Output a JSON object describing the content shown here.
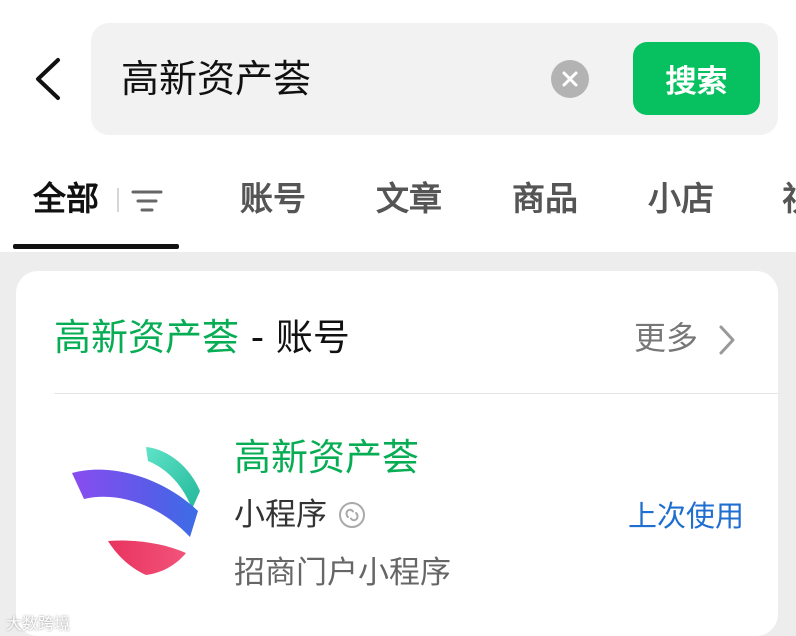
{
  "search": {
    "query": "高新资产荟",
    "button_label": "搜索"
  },
  "tabs": [
    {
      "label": "全部"
    },
    {
      "label": "账号"
    },
    {
      "label": "文章"
    },
    {
      "label": "商品"
    },
    {
      "label": "小店"
    },
    {
      "label": "视"
    }
  ],
  "section": {
    "keyword": "高新资产荟",
    "separator": " - ",
    "category": "账号",
    "more_label": "更多"
  },
  "result": {
    "name": "高新资产荟",
    "type": "小程序",
    "description": "招商门户小程序",
    "recent_label": "上次使用"
  },
  "watermark": "大数跨境",
  "colors": {
    "accent_green": "#07c160",
    "link_blue": "#1f6fd1"
  },
  "icons": [
    "back-arrow-icon",
    "clear-icon",
    "filter-icon",
    "chevron-right-icon",
    "link-icon"
  ]
}
